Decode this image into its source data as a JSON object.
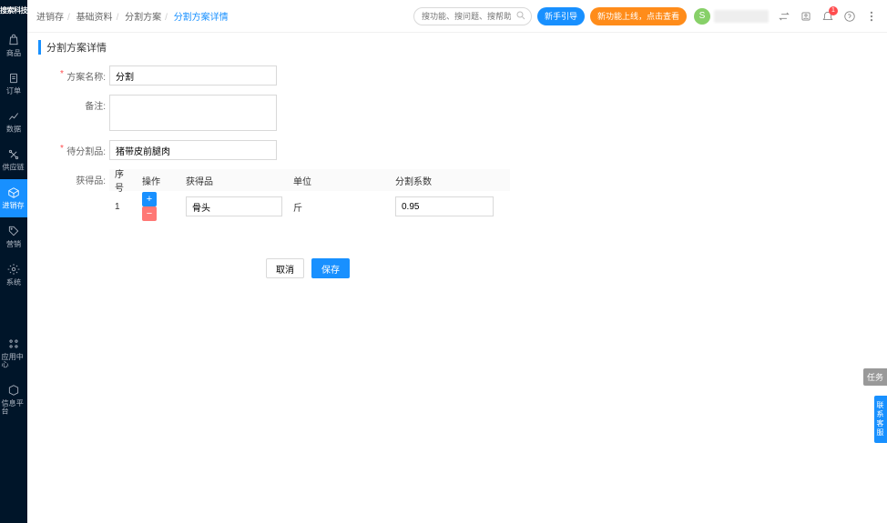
{
  "brand": "搜索科技",
  "sidebar": {
    "items": [
      {
        "label": "商品",
        "icon": "bag"
      },
      {
        "label": "订单",
        "icon": "doc"
      },
      {
        "label": "数据",
        "icon": "chart"
      },
      {
        "label": "供应链",
        "icon": "link"
      },
      {
        "label": "进销存",
        "icon": "box",
        "active": true
      },
      {
        "label": "营销",
        "icon": "tag"
      },
      {
        "label": "系统",
        "icon": "gear"
      }
    ],
    "bottom": [
      {
        "label": "应用中心",
        "icon": "apps"
      },
      {
        "label": "信息平台",
        "icon": "cube"
      }
    ]
  },
  "breadcrumb": {
    "items": [
      "进销存",
      "基础资料",
      "分割方案"
    ],
    "current": "分割方案详情"
  },
  "topbar": {
    "search_placeholder": "搜功能、搜问题、搜帮助",
    "guide_label": "新手引导",
    "feature_label": "新功能上线，点击查看",
    "avatar_letter": "S",
    "notif_count": "1"
  },
  "page": {
    "title": "分割方案详情",
    "labels": {
      "plan_name": "方案名称:",
      "remark": "备注:",
      "source_item": "待分割品:",
      "result_item": "获得品:"
    },
    "values": {
      "plan_name": "分割",
      "remark": "",
      "source_item": "猪带皮前腿肉"
    },
    "table": {
      "headers": {
        "no": "序号",
        "op": "操作",
        "item": "获得品",
        "unit": "单位",
        "coef": "分割系数"
      },
      "rows": [
        {
          "no": "1",
          "item": "骨头",
          "unit": "斤",
          "coef": "0.95"
        }
      ]
    },
    "buttons": {
      "cancel": "取消",
      "save": "保存"
    }
  },
  "floats": {
    "task": "任务",
    "contact": "联系客服"
  }
}
